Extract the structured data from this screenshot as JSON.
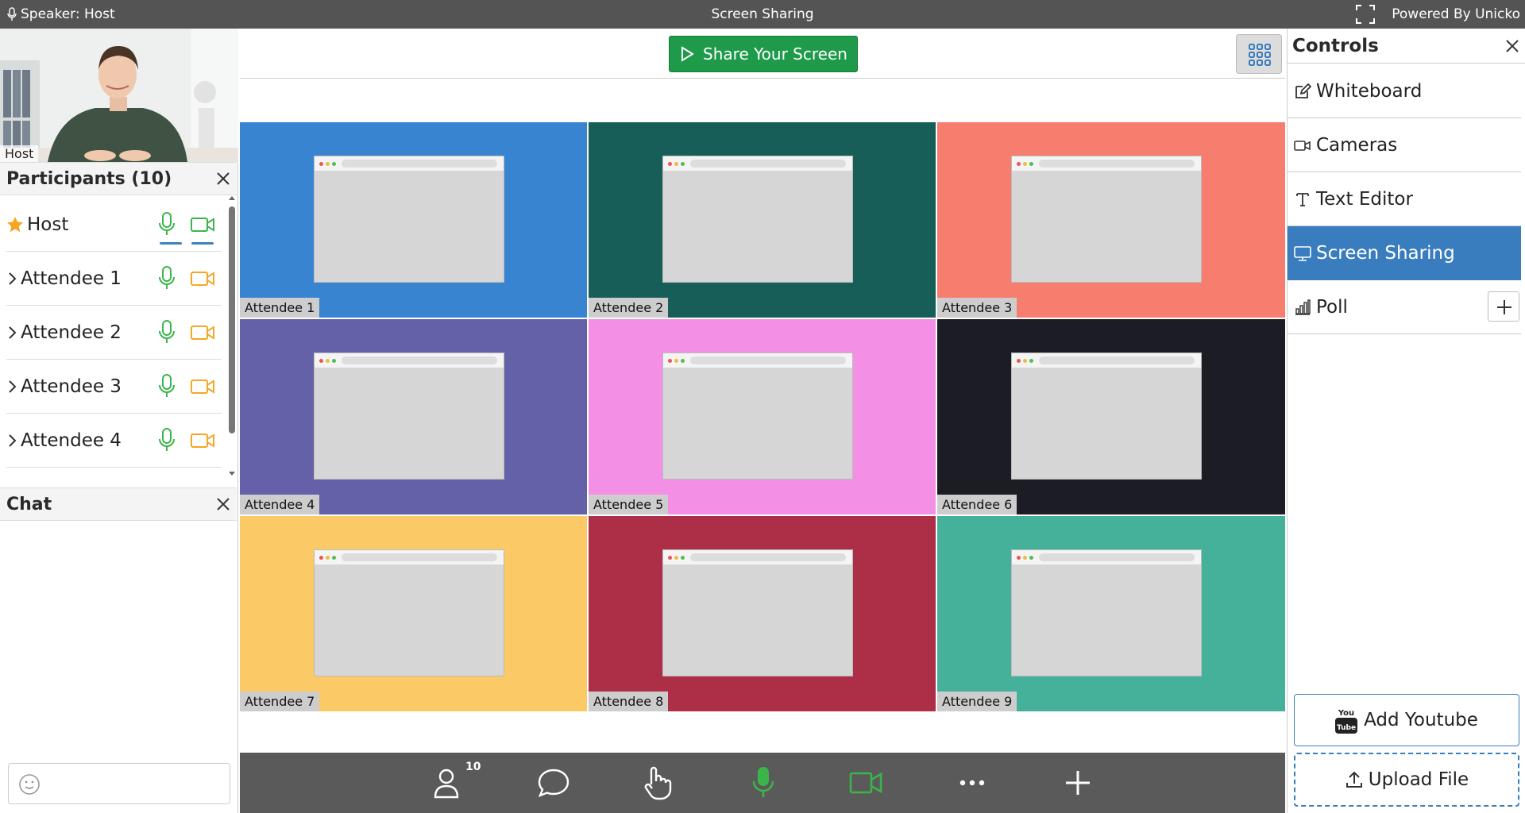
{
  "topbar": {
    "speaker": "Speaker: Host",
    "title": "Screen Sharing",
    "powered_by": "Powered By Unicko"
  },
  "host_video": {
    "label": "Host"
  },
  "participants": {
    "title": "Participants (10)",
    "items": [
      {
        "name": "Host",
        "role": "host"
      },
      {
        "name": "Attendee 1"
      },
      {
        "name": "Attendee 2"
      },
      {
        "name": "Attendee 3"
      },
      {
        "name": "Attendee 4"
      }
    ]
  },
  "chat": {
    "title": "Chat",
    "input_placeholder": ""
  },
  "center": {
    "share_button": "Share Your Screen",
    "tiles": [
      {
        "label": "Attendee 1",
        "color": "#3884d0"
      },
      {
        "label": "Attendee 2",
        "color": "#165e57"
      },
      {
        "label": "Attendee 3",
        "color": "#f77d6f"
      },
      {
        "label": "Attendee 4",
        "color": "#6461a8"
      },
      {
        "label": "Attendee 5",
        "color": "#f48fe6"
      },
      {
        "label": "Attendee 6",
        "color": "#1c1c24"
      },
      {
        "label": "Attendee 7",
        "color": "#fbc966"
      },
      {
        "label": "Attendee 8",
        "color": "#ad2f47"
      },
      {
        "label": "Attendee 9",
        "color": "#45b19b"
      }
    ],
    "toolbar": {
      "participants_count": "10",
      "icons": [
        "participants-icon",
        "chat-icon",
        "raise-hand-icon",
        "microphone-icon",
        "camera-icon",
        "more-icon",
        "add-icon"
      ]
    }
  },
  "controls": {
    "title": "Controls",
    "items": [
      {
        "label": "Whiteboard",
        "icon": "pencil-icon"
      },
      {
        "label": "Cameras",
        "icon": "camera-icon"
      },
      {
        "label": "Text Editor",
        "icon": "text-icon"
      },
      {
        "label": "Screen Sharing",
        "icon": "monitor-icon",
        "active": true
      },
      {
        "label": "Poll",
        "icon": "poll-icon"
      }
    ],
    "add_youtube": "Add Youtube",
    "upload_file": "Upload File"
  },
  "colors": {
    "accent": "#3a7dbf",
    "green": "#1f9a4a",
    "mic_green": "#3bb54a",
    "cam_orange": "#f5a623",
    "topbar": "#545454"
  }
}
